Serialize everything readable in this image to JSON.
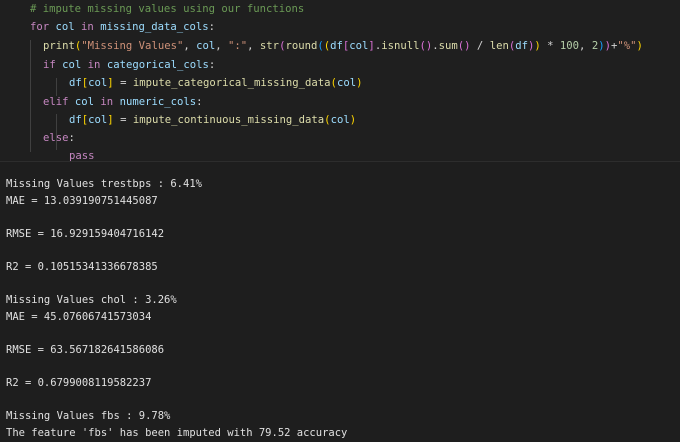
{
  "code_cell": {
    "lines": [
      {
        "indent": 1,
        "tokens": [
          {
            "t": "# impute missing values using our functions",
            "c": "cm"
          }
        ]
      },
      {
        "indent": 1,
        "tokens": [
          {
            "t": "for",
            "c": "kw"
          },
          {
            "t": " ",
            "c": "pl"
          },
          {
            "t": "col",
            "c": "vr"
          },
          {
            "t": " in ",
            "c": "kw"
          },
          {
            "t": "missing_data_cols",
            "c": "vr"
          },
          {
            "t": ":",
            "c": "pl"
          }
        ]
      },
      {
        "indent": 2,
        "tokens": [
          {
            "t": "print",
            "c": "fn"
          },
          {
            "t": "(",
            "c": "b1"
          },
          {
            "t": "\"Missing Values\"",
            "c": "st"
          },
          {
            "t": ", ",
            "c": "pl"
          },
          {
            "t": "col",
            "c": "vr"
          },
          {
            "t": ", ",
            "c": "pl"
          },
          {
            "t": "\":\"",
            "c": "st"
          },
          {
            "t": ", ",
            "c": "pl"
          },
          {
            "t": "str",
            "c": "fn"
          },
          {
            "t": "(",
            "c": "b2"
          },
          {
            "t": "round",
            "c": "fn"
          },
          {
            "t": "(",
            "c": "b3"
          },
          {
            "t": "(",
            "c": "b1"
          },
          {
            "t": "df",
            "c": "vr"
          },
          {
            "t": "[",
            "c": "b2"
          },
          {
            "t": "col",
            "c": "vr"
          },
          {
            "t": "]",
            "c": "b2"
          },
          {
            "t": ".",
            "c": "pl"
          },
          {
            "t": "isnull",
            "c": "fn"
          },
          {
            "t": "()",
            "c": "b2"
          },
          {
            "t": ".",
            "c": "pl"
          },
          {
            "t": "sum",
            "c": "fn"
          },
          {
            "t": "()",
            "c": "b2"
          },
          {
            "t": " / ",
            "c": "pl"
          },
          {
            "t": "len",
            "c": "fn"
          },
          {
            "t": "(",
            "c": "b2"
          },
          {
            "t": "df",
            "c": "vr"
          },
          {
            "t": ")",
            "c": "b2"
          },
          {
            "t": ")",
            "c": "b1"
          },
          {
            "t": " * ",
            "c": "pl"
          },
          {
            "t": "100",
            "c": "nu"
          },
          {
            "t": ", ",
            "c": "pl"
          },
          {
            "t": "2",
            "c": "nu"
          },
          {
            "t": ")",
            "c": "b3"
          },
          {
            "t": ")",
            "c": "b2"
          },
          {
            "t": "+",
            "c": "pl"
          },
          {
            "t": "\"%\"",
            "c": "st"
          },
          {
            "t": ")",
            "c": "b1"
          }
        ]
      },
      {
        "indent": 2,
        "tokens": [
          {
            "t": "if",
            "c": "kw"
          },
          {
            "t": " ",
            "c": "pl"
          },
          {
            "t": "col",
            "c": "vr"
          },
          {
            "t": " in ",
            "c": "kw"
          },
          {
            "t": "categorical_cols",
            "c": "vr"
          },
          {
            "t": ":",
            "c": "pl"
          }
        ]
      },
      {
        "indent": 3,
        "tokens": [
          {
            "t": "df",
            "c": "vr"
          },
          {
            "t": "[",
            "c": "b1"
          },
          {
            "t": "col",
            "c": "vr"
          },
          {
            "t": "]",
            "c": "b1"
          },
          {
            "t": " = ",
            "c": "pl"
          },
          {
            "t": "impute_categorical_missing_data",
            "c": "fn"
          },
          {
            "t": "(",
            "c": "b1"
          },
          {
            "t": "col",
            "c": "vr"
          },
          {
            "t": ")",
            "c": "b1"
          }
        ]
      },
      {
        "indent": 2,
        "tokens": [
          {
            "t": "elif",
            "c": "kw"
          },
          {
            "t": " ",
            "c": "pl"
          },
          {
            "t": "col",
            "c": "vr"
          },
          {
            "t": " in ",
            "c": "kw"
          },
          {
            "t": "numeric_cols",
            "c": "vr"
          },
          {
            "t": ":",
            "c": "pl"
          }
        ]
      },
      {
        "indent": 3,
        "tokens": [
          {
            "t": "df",
            "c": "vr"
          },
          {
            "t": "[",
            "c": "b1"
          },
          {
            "t": "col",
            "c": "vr"
          },
          {
            "t": "]",
            "c": "b1"
          },
          {
            "t": " = ",
            "c": "pl"
          },
          {
            "t": "impute_continuous_missing_data",
            "c": "fn"
          },
          {
            "t": "(",
            "c": "b1"
          },
          {
            "t": "col",
            "c": "vr"
          },
          {
            "t": ")",
            "c": "b1"
          }
        ]
      },
      {
        "indent": 2,
        "tokens": [
          {
            "t": "else",
            "c": "kw"
          },
          {
            "t": ":",
            "c": "pl"
          }
        ]
      },
      {
        "indent": 3,
        "tokens": [
          {
            "t": "pass",
            "c": "kw"
          }
        ]
      }
    ]
  },
  "output": {
    "lines": [
      "Missing Values trestbps : 6.41%",
      "MAE = 13.039190751445087",
      "",
      "RMSE = 16.929159404716142",
      "",
      "R2 = 0.10515341336678385",
      "",
      "Missing Values chol : 3.26%",
      "MAE = 45.07606741573034",
      "",
      "RMSE = 63.567182641586086",
      "",
      "R2 = 0.6799008119582237",
      "",
      "Missing Values fbs : 9.78%",
      "The feature 'fbs' has been imputed with 79.52 accuracy"
    ]
  }
}
